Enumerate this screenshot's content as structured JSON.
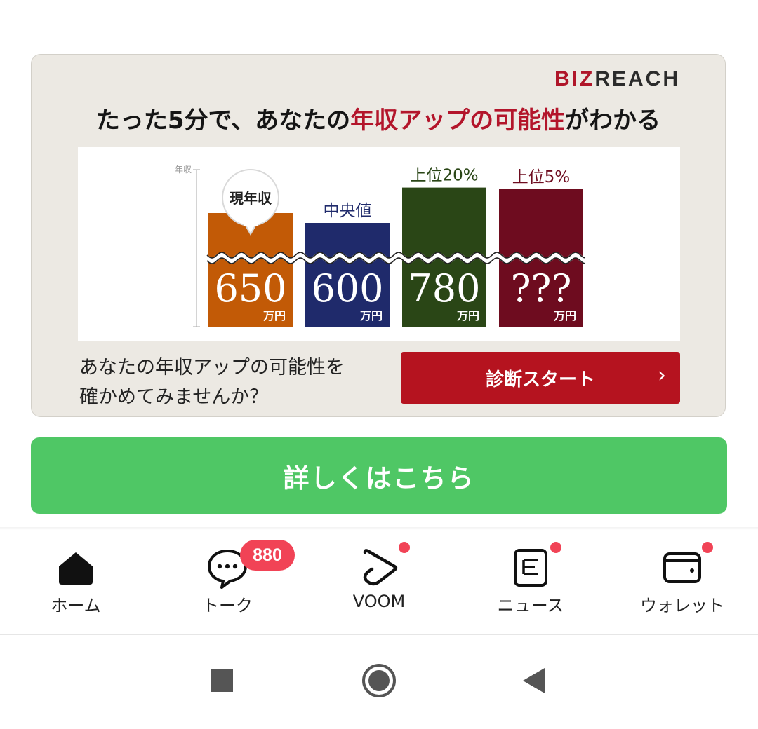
{
  "ad": {
    "brand_red": "BIZ",
    "brand_dark": "REACH",
    "headline_pre": "たった5分で、あなたの",
    "headline_highlight": "年収アップの可能性",
    "headline_post": "がわかる",
    "chart_axis_label": "年収",
    "bubble_label": "現年収",
    "bottom_line1": "あなたの年収アップの可能性を",
    "bottom_line2": "確かめてみませんか？",
    "cta_label": "診断スタート",
    "cta_chevron": "›"
  },
  "chart_data": {
    "type": "bar",
    "categories": [
      "現年収",
      "中央値",
      "上位20%",
      "上位5%"
    ],
    "value_labels": [
      "650",
      "600",
      "780",
      "???"
    ],
    "unit": "万円",
    "values": [
      650,
      600,
      780,
      null
    ],
    "colors": [
      "#c25a06",
      "#1f2a6b",
      "#2a4616",
      "#6e0c1f"
    ],
    "label_colors": [
      "#222222",
      "#1f2a6b",
      "#2a4616",
      "#6e0c1f"
    ]
  },
  "details_button": {
    "label": "詳しくはこちら"
  },
  "tabbar": {
    "items": [
      {
        "label": "ホーム",
        "icon": "home-icon"
      },
      {
        "label": "トーク",
        "icon": "chat-icon",
        "badge": "880"
      },
      {
        "label": "VOOM",
        "icon": "voom-play-icon"
      },
      {
        "label": "ニュース",
        "icon": "news-icon"
      },
      {
        "label": "ウォレット",
        "icon": "wallet-icon"
      }
    ]
  },
  "colors": {
    "line_green": "#4fc765",
    "badge_red": "#f14356",
    "cta_red": "#b5131f",
    "highlight_red": "#b3152b"
  }
}
